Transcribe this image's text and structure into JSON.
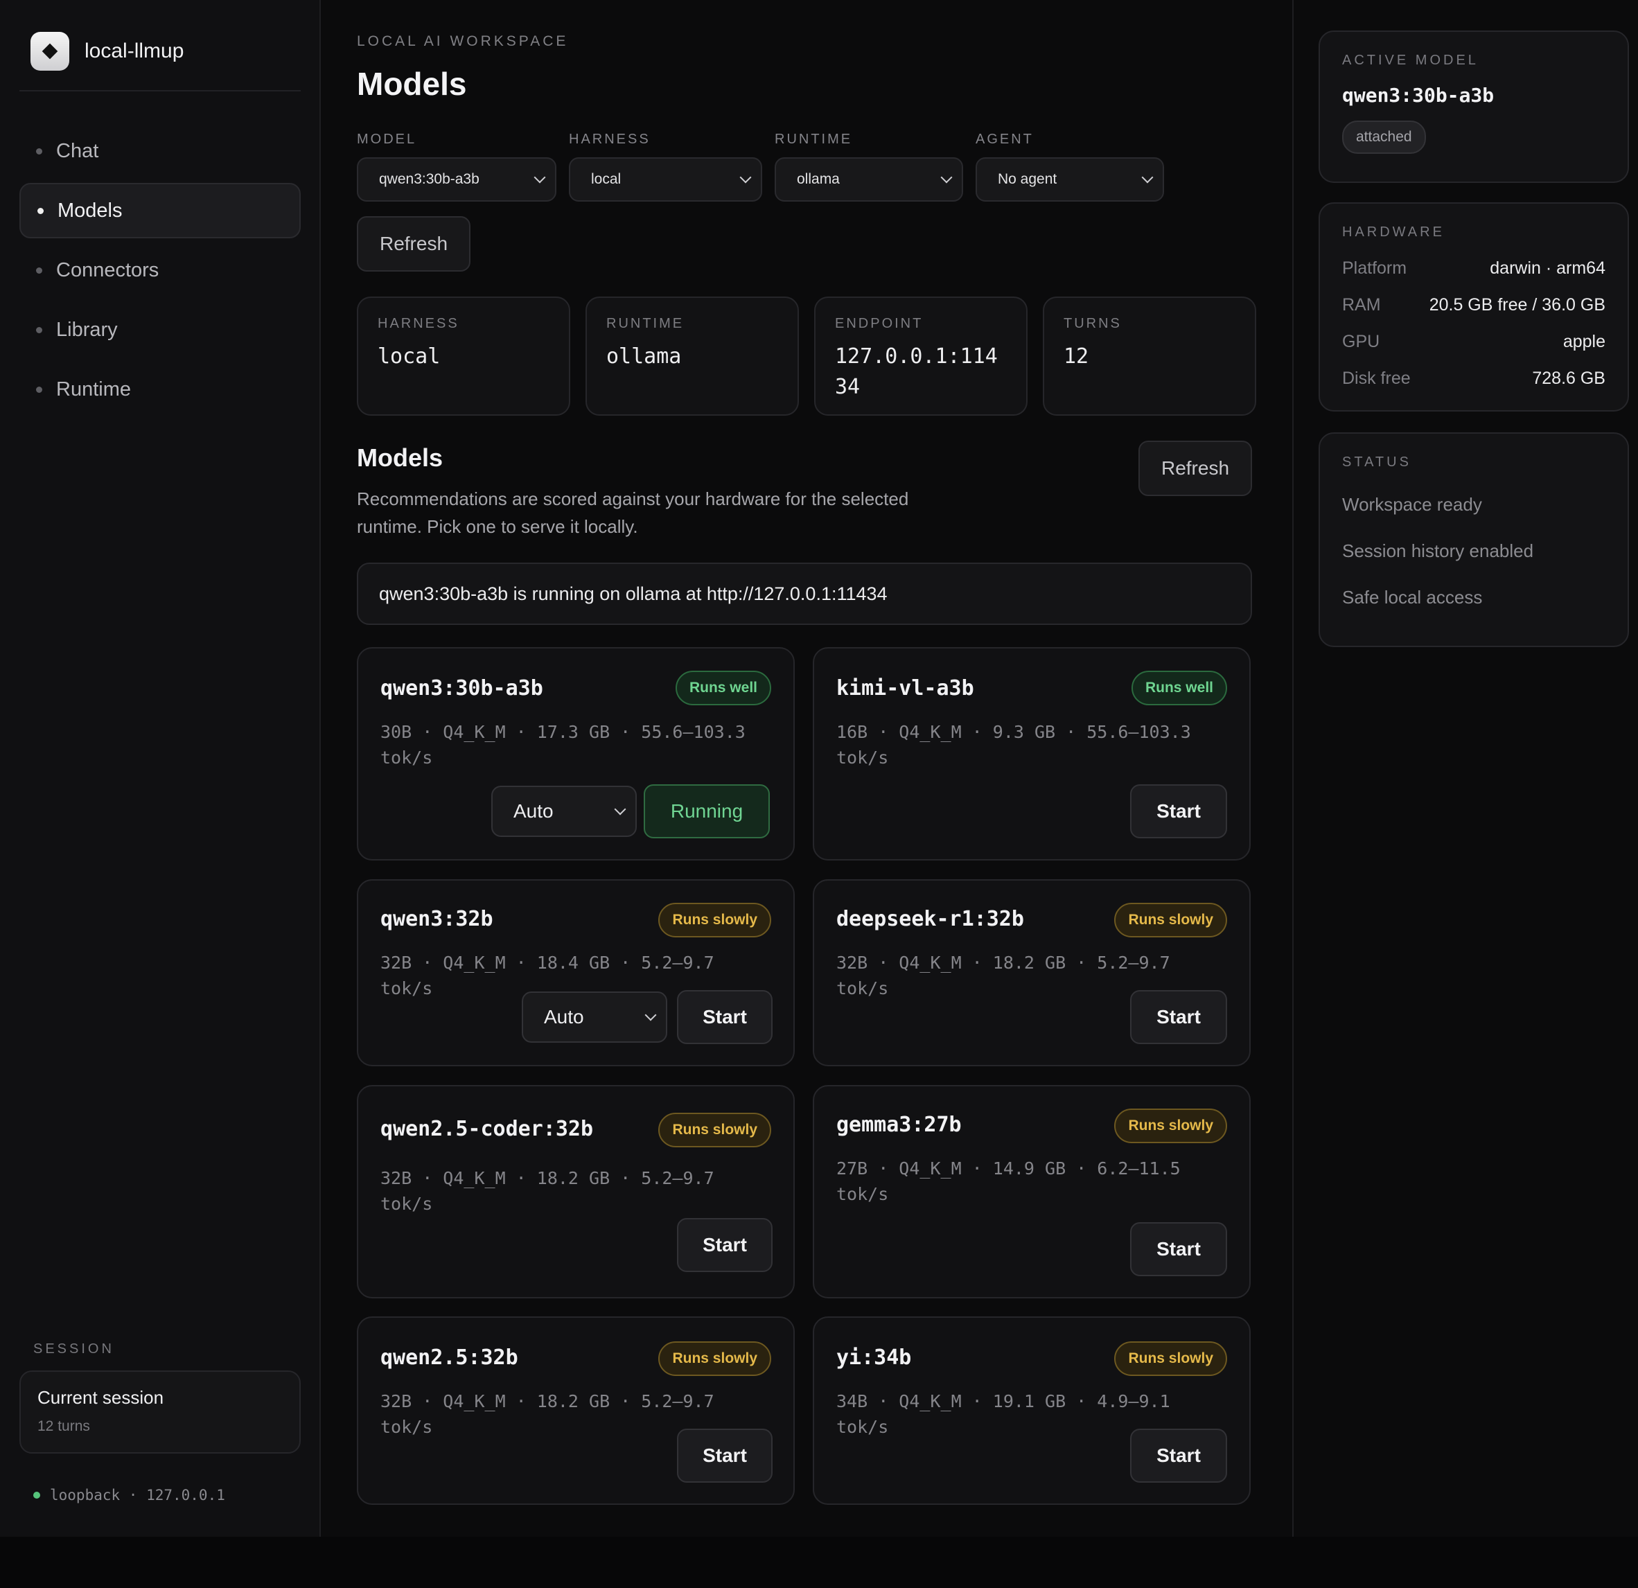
{
  "brand": {
    "name": "local-llmup",
    "logo_icon": "diamond-icon"
  },
  "sidebar": {
    "items": [
      {
        "label": "Chat",
        "active": false
      },
      {
        "label": "Models",
        "active": true
      },
      {
        "label": "Connectors",
        "active": false
      },
      {
        "label": "Library",
        "active": false
      },
      {
        "label": "Runtime",
        "active": false
      }
    ],
    "session_label": "SESSION",
    "session_title": "Current session",
    "session_sub": "12 turns",
    "loopback": "loopback · 127.0.0.1"
  },
  "main": {
    "eyebrow": "LOCAL AI WORKSPACE",
    "title": "Models",
    "selectors": {
      "model": {
        "label": "MODEL",
        "value": "qwen3:30b-a3b"
      },
      "harness": {
        "label": "HARNESS",
        "value": "local"
      },
      "runtime": {
        "label": "RUNTIME",
        "value": "ollama"
      },
      "agent": {
        "label": "AGENT",
        "value": "No agent"
      }
    },
    "refresh_label": "Refresh",
    "stats": [
      {
        "label": "HARNESS",
        "value": "local"
      },
      {
        "label": "RUNTIME",
        "value": "ollama"
      },
      {
        "label": "ENDPOINT",
        "value": "127.0.0.1:11434"
      },
      {
        "label": "TURNS",
        "value": "12"
      }
    ],
    "section_title": "Models",
    "section_desc": "Recommendations are scored against your hardware for the selected runtime. Pick one to serve it locally.",
    "section_refresh": "Refresh",
    "notice": "qwen3:30b-a3b is running on ollama at http://127.0.0.1:11434",
    "cards": [
      {
        "name": "qwen3:30b-a3b",
        "badge": "Runs well",
        "spec": "30B · Q4_K_M · 17.3 GB · 55.6–103.3 tok/s",
        "select": "Auto",
        "action": "Running"
      },
      {
        "name": "kimi-vl-a3b",
        "badge": "Runs well",
        "spec": "16B · Q4_K_M · 9.3 GB · 55.6–103.3 tok/s",
        "action": "Start"
      },
      {
        "name": "qwen3:32b",
        "badge": "Runs slowly",
        "spec": "32B · Q4_K_M · 18.4 GB · 5.2–9.7 tok/s",
        "select": "Auto",
        "action": "Start"
      },
      {
        "name": "deepseek-r1:32b",
        "badge": "Runs slowly",
        "spec": "32B · Q4_K_M · 18.2 GB · 5.2–9.7 tok/s",
        "action": "Start"
      },
      {
        "name": "qwen2.5-coder:32b",
        "badge": "Runs slowly",
        "spec": "32B · Q4_K_M · 18.2 GB · 5.2–9.7 tok/s",
        "action": "Start"
      },
      {
        "name": "gemma3:27b",
        "badge": "Runs slowly",
        "spec": "27B · Q4_K_M · 14.9 GB · 6.2–11.5 tok/s",
        "action": "Start"
      },
      {
        "name": "qwen2.5:32b",
        "badge": "Runs slowly",
        "spec": "32B · Q4_K_M · 18.2 GB · 5.2–9.7 tok/s",
        "action": "Start"
      },
      {
        "name": "yi:34b",
        "badge": "Runs slowly",
        "spec": "34B · Q4_K_M · 19.1 GB · 4.9–9.1 tok/s",
        "action": "Start"
      }
    ]
  },
  "right": {
    "active_label": "ACTIVE MODEL",
    "active_name": "qwen3:30b-a3b",
    "active_pill": "attached",
    "hardware_label": "HARDWARE",
    "hardware": [
      {
        "k": "Platform",
        "v": "darwin · arm64"
      },
      {
        "k": "RAM",
        "v": "20.5 GB free / 36.0 GB"
      },
      {
        "k": "GPU",
        "v": "apple"
      },
      {
        "k": "Disk free",
        "v": "728.6 GB"
      }
    ],
    "status_label": "STATUS",
    "status": [
      "Workspace ready",
      "Session history enabled",
      "Safe local access"
    ]
  },
  "colors": {
    "good": "#6fd591",
    "slow": "#e5b94a",
    "accent_dot": "#56c47b"
  }
}
